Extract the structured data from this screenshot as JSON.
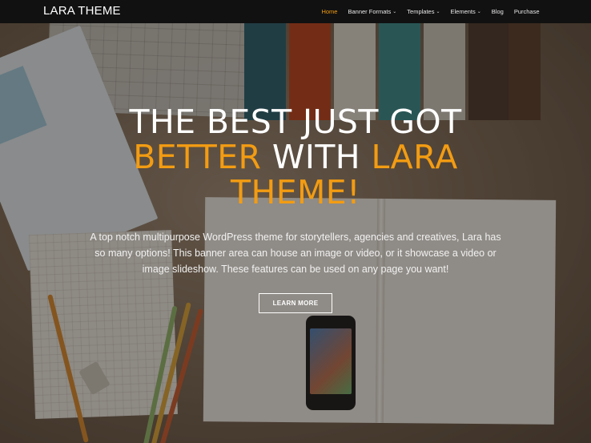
{
  "site": {
    "logo": "LARA THEME"
  },
  "nav": {
    "items": [
      {
        "label": "Home",
        "active": true,
        "dropdown": false
      },
      {
        "label": "Banner Formats",
        "active": false,
        "dropdown": true
      },
      {
        "label": "Templates",
        "active": false,
        "dropdown": true
      },
      {
        "label": "Elements",
        "active": false,
        "dropdown": true
      },
      {
        "label": "Blog",
        "active": false,
        "dropdown": false
      },
      {
        "label": "Purchase",
        "active": false,
        "dropdown": false
      }
    ],
    "caret_icon": "chevron-down-icon"
  },
  "hero": {
    "title_line1": "THE BEST JUST GOT",
    "title_accent1": "BETTER",
    "title_mid": "WITH",
    "title_accent2": "LARA",
    "title_line3": "THEME!",
    "description": "A top notch multipurpose WordPress theme for storytellers, agencies and creatives, Lara has so many options! This banner area can house an image or video, or it showcase a video or image slideshow. These features can be used on any page you want!",
    "cta_label": "LEARN MORE"
  },
  "colors": {
    "accent": "#f39c12",
    "header_bg": "#111111",
    "text": "#ffffff"
  }
}
